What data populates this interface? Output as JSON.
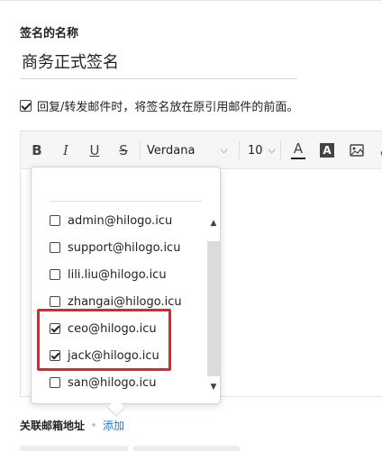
{
  "signature": {
    "name_label": "签名的名称",
    "name_value": "商务正式签名"
  },
  "reply_option": {
    "checked": true,
    "label": "回复/转发邮件时，将签名放在原引用邮件的前面。"
  },
  "toolbar": {
    "bold_icon": "B",
    "italic_icon": "I",
    "underline_icon": "U",
    "strike_icon": "S",
    "font_family": "Verdana",
    "font_size": "10",
    "font_color_icon": "A",
    "highlight_icon": "A"
  },
  "address_popup": {
    "items": [
      {
        "label": "admin@hilogo.icu",
        "checked": false
      },
      {
        "label": "support@hilogo.icu",
        "checked": false
      },
      {
        "label": "lili.liu@hilogo.icu",
        "checked": false
      },
      {
        "label": "zhangai@hilogo.icu",
        "checked": false
      },
      {
        "label": "ceo@hilogo.icu",
        "checked": true
      },
      {
        "label": "jack@hilogo.icu",
        "checked": true
      },
      {
        "label": "san@hilogo.icu",
        "checked": false
      }
    ]
  },
  "associated": {
    "label": "关联邮箱地址",
    "add_link": "添加"
  },
  "colors": {
    "accent": "#1e78d0",
    "highlight_box": "#e0262b"
  }
}
